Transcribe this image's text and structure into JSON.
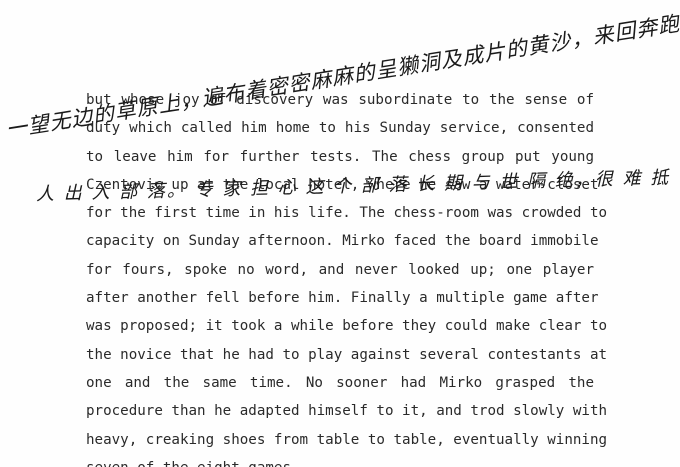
{
  "document": {
    "lines": [
      "but whose joy of discovery was subordinate to the sense of",
      "duty which called him home to his Sunday service, consented",
      "to leave him for further tests. The chess group put young",
      "Czentovic up at the local hotel, where he saw a water-closet",
      "for the first time in his life. The chess-room was crowded to",
      "capacity on Sunday afternoon. Mirko faced the board immobile",
      "for fours, spoke no word, and never looked up; one player",
      "after another fell before him. Finally a multiple game after",
      "was proposed; it took a while before they could make clear to",
      "the novice that he had to play against several contestants at",
      "one and the same time. No sooner had Mirko grasped the",
      "procedure than he adapted himself to it, and trod slowly with",
      "heavy, creaking shoes from table to table, eventually winning",
      "seven of the eight games."
    ]
  },
  "handwriting": {
    "line1": "一望无边的草原上，遍布着密密麻麻的呈獭洞及成片的黄沙，来回奔跑，",
    "line2": "人 出 入 部 落。 专 家 担 心 这 个 部 落 长 期 与 世 隔 绝，很 难 抵"
  }
}
